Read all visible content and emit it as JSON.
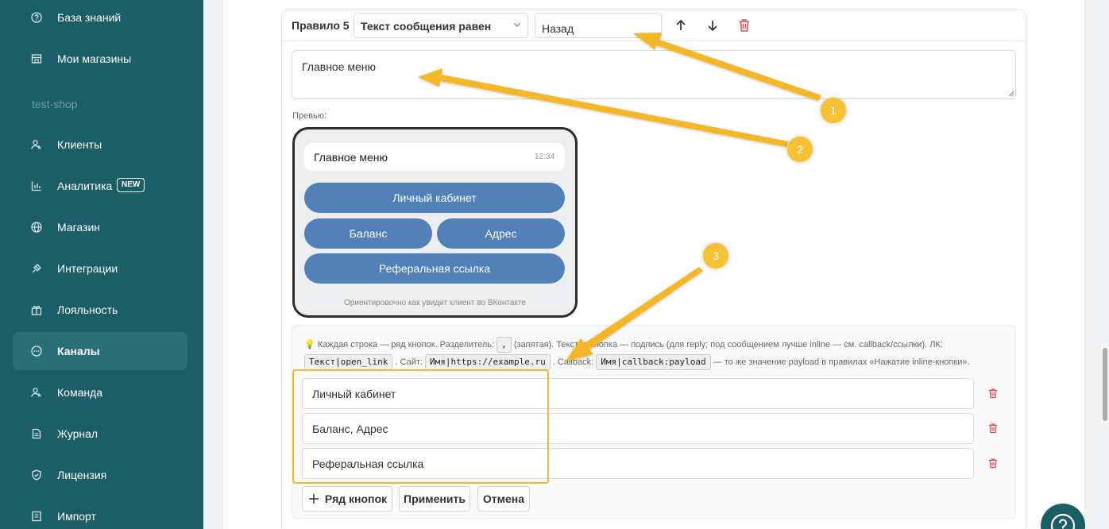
{
  "sidebar": {
    "items": [
      {
        "label": "База знаний",
        "icon": "help-circle-icon"
      },
      {
        "label": "Мои магазины",
        "icon": "store-icon"
      },
      {
        "label": "Клиенты",
        "icon": "users-icon"
      },
      {
        "label": "Аналитика",
        "icon": "bar-chart-icon",
        "badge": "NEW"
      },
      {
        "label": "Магазин",
        "icon": "globe-icon"
      },
      {
        "label": "Интеграции",
        "icon": "plug-icon"
      },
      {
        "label": "Лояльность",
        "icon": "gift-icon"
      },
      {
        "label": "Каналы",
        "icon": "chat-icon",
        "active": true
      },
      {
        "label": "Команда",
        "icon": "team-icon"
      },
      {
        "label": "Журнал",
        "icon": "journal-icon"
      },
      {
        "label": "Лицензия",
        "icon": "shield-check-icon"
      },
      {
        "label": "Импорт",
        "icon": "import-icon"
      }
    ],
    "section_label": "test-shop"
  },
  "rule": {
    "label": "Правило 5",
    "condition_select": "Текст сообщения равен",
    "match_value": "Назад",
    "response_text": "Главное меню"
  },
  "preview": {
    "label": "Превью:",
    "message_text": "Главное меню",
    "message_time": "12:34",
    "buttons": {
      "row1": "Личный кабинет",
      "row2_left": "Баланс",
      "row2_right": "Адрес",
      "row3": "Реферальная ссылка"
    },
    "caption": "Ориентировочно как увидит клиент во ВКонтакте"
  },
  "hint": {
    "line1_a": "Каждая строка — ряд кнопок. Разделитель:",
    "line1_code": ",",
    "line1_b": "(запятая). Текстов",
    "line1_c": "кнопка — подпись (для reply; под сообщением лучше inline — см. callback/ссылки). ЛК:",
    "line2_code1": "Текст|open_link",
    "line2_a": ". Сайт:",
    "line2_code2": "Имя|https://example.ru",
    "line2_b": ". Callback:",
    "line2_code3": "Имя|callback:payload",
    "line2_c": "— то же значение payload в правилах «Нажатие inline-кнопки»."
  },
  "keyboard_rows": [
    "Личный кабинет",
    "Баланс, Адрес",
    "Реферальная ссылка"
  ],
  "footer": {
    "add_row_label": "Ряд кнопок",
    "apply_label": "Применить",
    "cancel_label": "Отмена"
  },
  "annotations": [
    "1",
    "2",
    "3"
  ],
  "colors": {
    "sidebar_bg": "#1b5e66",
    "vk_button": "#5181b8",
    "annotation_yellow": "#f6c234",
    "delete_red": "#e5484d"
  }
}
